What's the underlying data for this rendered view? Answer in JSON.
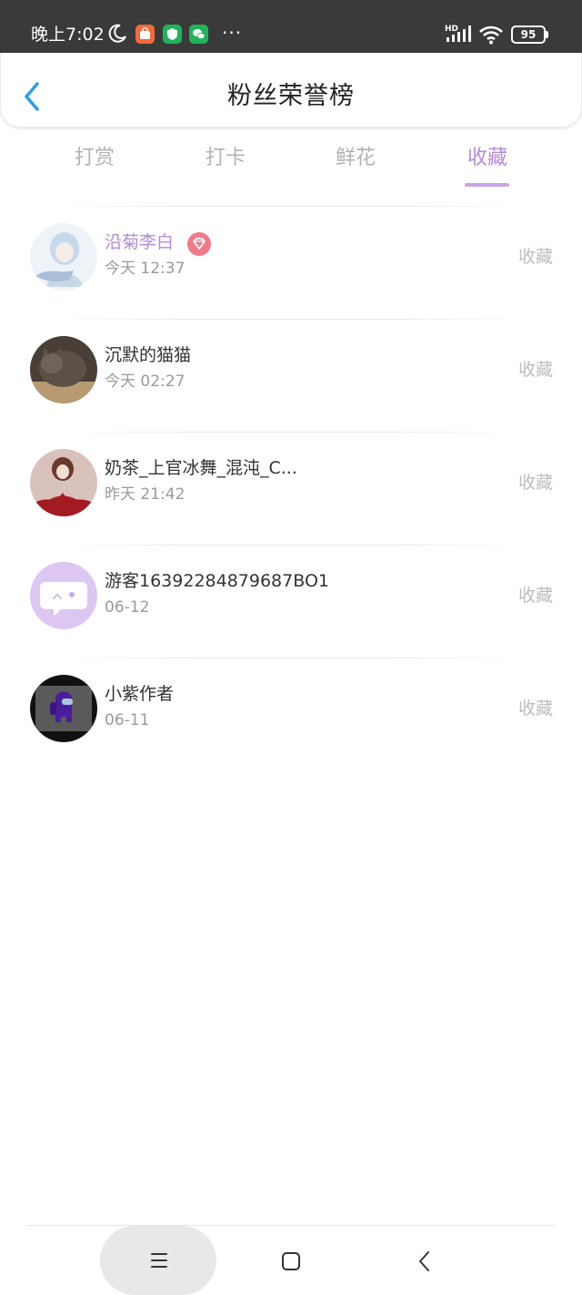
{
  "status_bar": {
    "time": "晚上7:02",
    "battery": "95",
    "network_label": "HD"
  },
  "header": {
    "title": "粉丝荣誉榜"
  },
  "tabs": [
    {
      "label": "打赏",
      "active": false
    },
    {
      "label": "打卡",
      "active": false
    },
    {
      "label": "鲜花",
      "active": false
    },
    {
      "label": "收藏",
      "active": true
    }
  ],
  "fans": [
    {
      "name": "沿菊李白",
      "time": "今天 12:37",
      "action": "收藏",
      "vip": true,
      "avatar": "anime-girl-avatar"
    },
    {
      "name": "沉默的猫猫",
      "time": "今天 02:27",
      "action": "收藏",
      "vip": false,
      "avatar": "cat-avatar"
    },
    {
      "name": "奶茶_上官冰舞_混沌_C...",
      "time": "昨天 21:42",
      "action": "收藏",
      "vip": false,
      "avatar": "red-dress-avatar"
    },
    {
      "name": "游客16392284879687BO1",
      "time": "06-12",
      "action": "收藏",
      "vip": false,
      "avatar": "chat-bubble-avatar"
    },
    {
      "name": "小紫作者",
      "time": "06-11",
      "action": "收藏",
      "vip": false,
      "avatar": "among-us-avatar"
    }
  ],
  "colors": {
    "accent": "#b58bd9",
    "back_arrow": "#2a9fe8",
    "status_bar_bg": "#3a3a3a",
    "vip_badge": "#f07b87"
  },
  "nav": {
    "icons": [
      "menu-icon",
      "home-square-icon",
      "back-chevron-icon"
    ]
  }
}
